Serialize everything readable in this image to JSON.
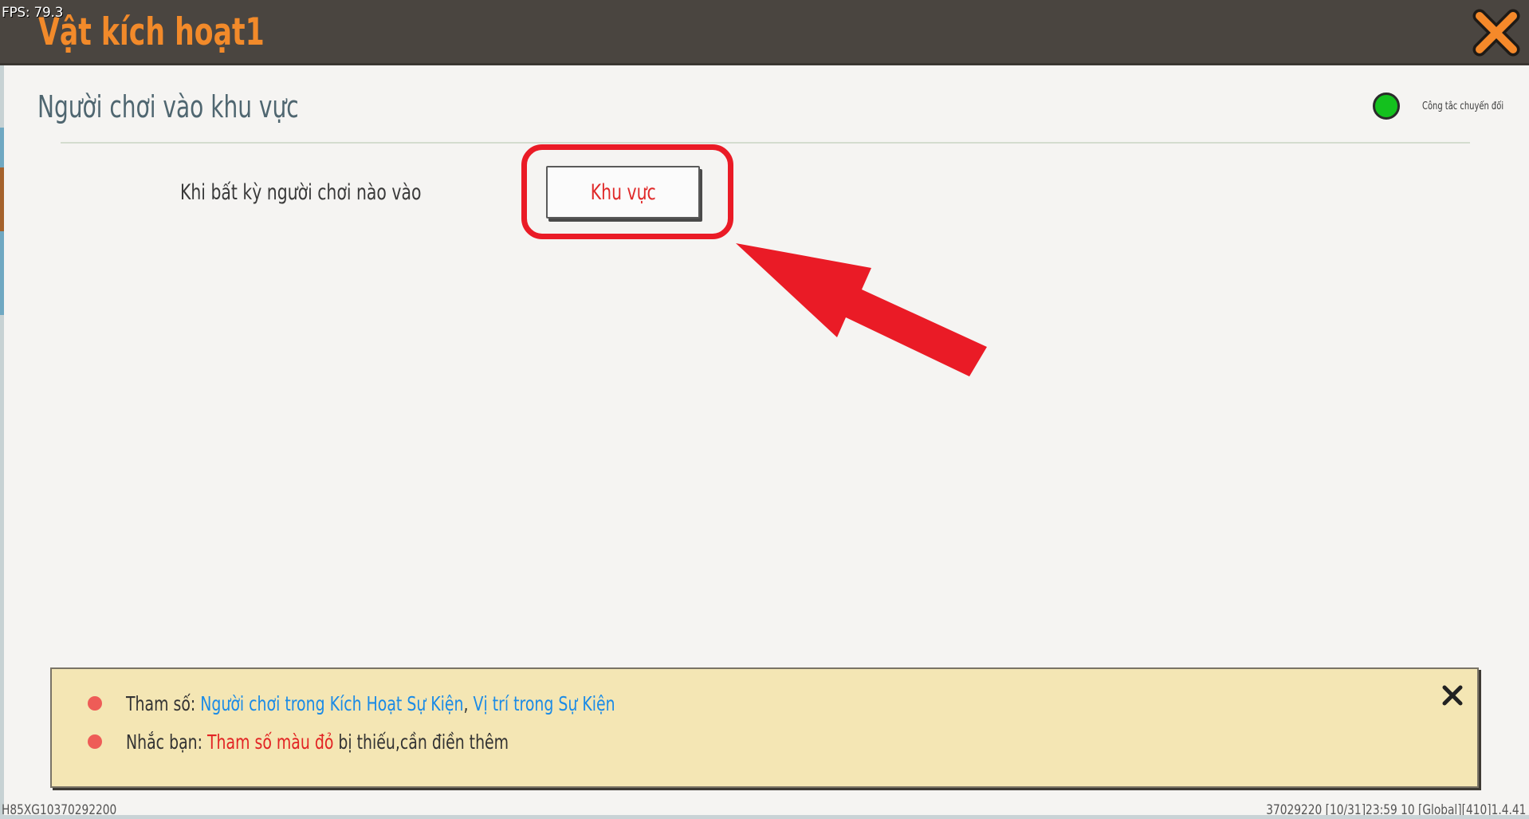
{
  "overlay": {
    "fps": "FPS: 79.3"
  },
  "window": {
    "title": "Vật kích hoạt1"
  },
  "trigger": {
    "section_title": "Người chơi vào khu vực",
    "toggle_label": "Công tắc chuyển đổi",
    "toggle_state": "on",
    "condition_text": "Khi bất kỳ người chơi nào vào",
    "area_button_label": "Khu vực"
  },
  "info": {
    "params_label": "Tham số: ",
    "param_1": "Người chơi trong Kích Hoạt Sự Kiện",
    "param_separator": ", ",
    "param_2": "Vị trí trong Sự Kiện",
    "reminder_label": "Nhắc bạn: ",
    "reminder_highlight": "Tham số màu đỏ",
    "reminder_rest": " bị thiếu,cần điền thêm"
  },
  "footer": {
    "left_id": "H85XG10370292200",
    "right_info": "37029220 [10/31]23:59 10 [Global][410]1.4.41"
  },
  "colors": {
    "title_orange": "#f28a2a",
    "toggle_green": "#14c11e",
    "highlight_red": "#ea1b26",
    "param_blue": "#1b8be6",
    "info_bg": "#f4e6b4"
  }
}
